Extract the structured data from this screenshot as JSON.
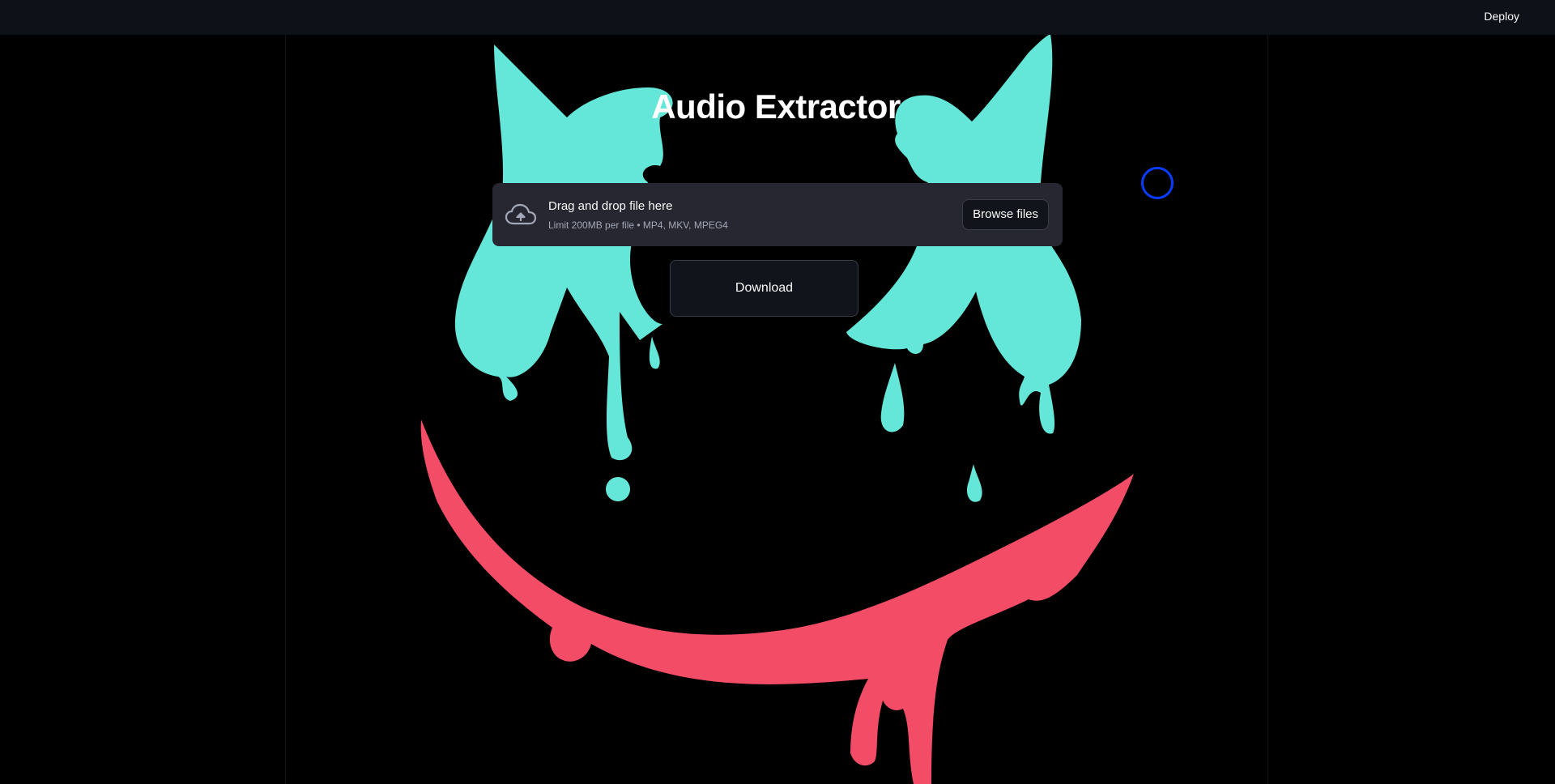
{
  "header": {
    "deploy_label": "Deploy"
  },
  "main": {
    "title": "Audio Extractor",
    "uploader": {
      "icon": "cloud-upload-icon",
      "drop_text": "Drag and drop file here",
      "limit_text": "Limit 200MB per file • MP4, MKV, MPEG4",
      "browse_label": "Browse files"
    },
    "download_label": "Download"
  },
  "colors": {
    "background": "#000000",
    "topbar": "#0e1118",
    "teal_art": "#64e6d8",
    "red_art": "#f24c66",
    "focus_ring": "#0a3cff"
  }
}
